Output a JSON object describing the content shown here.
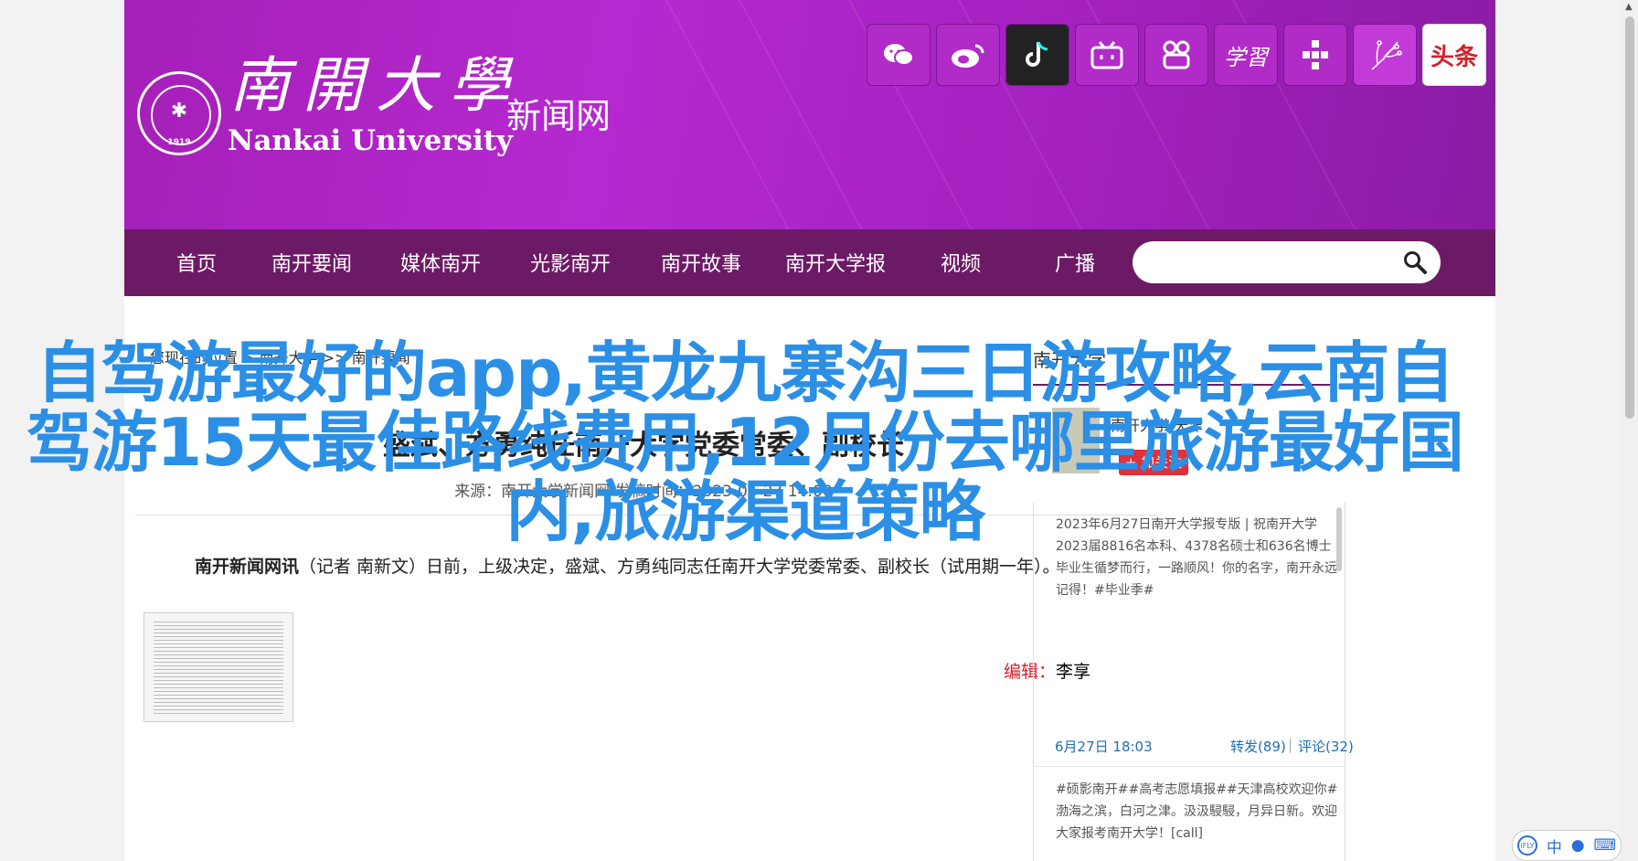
{
  "header": {
    "logo_cn": "南開大學",
    "logo_en": "Nankai University",
    "site_name": "新闻网",
    "emblem_year": "1919",
    "social_icons": [
      "wechat-icon",
      "weibo-icon",
      "douyin-icon",
      "bilibili-icon",
      "kuaishou-icon",
      "xuexi-icon",
      "app-icon",
      "flower-icon",
      "toutiao-icon"
    ],
    "toutiao_label": "头条"
  },
  "nav": {
    "items": [
      "首页",
      "南开要闻",
      "媒体南开",
      "光影南开",
      "南开故事",
      "南开大学报",
      "视频",
      "广播"
    ],
    "search_placeholder": ""
  },
  "article": {
    "breadcrumb": "您现在的位置 > 南开大学 >> 南开要闻",
    "title": "盛斌、方勇纯任南开大学党委常委、副校长",
    "meta": "来源：南开大学新闻网    发稿时间：2023-06-27 14:00",
    "body_lead": "南开新闻网讯",
    "body_text": "（记者 南新文）日前，上级决定，盛斌、方勇纯同志任南开大学党委常委、副校长（试用期一年）。",
    "editor_label": "编辑：",
    "editor_name": "李享"
  },
  "sidebar": {
    "heading": "南开大学",
    "weibo_name": "南开大学 天津",
    "follow_label": "+ 加关注",
    "feed_text_1": "2023年6月27日南开大学报专版 | 祝南开大学2023届8816名本科、4378名硕士和636名博士毕业生循梦而行，一路顺风！你的名字，南开永远记得！#毕业季#",
    "feed_date": "6月27日 18:03",
    "feed_repost": "转发(89)",
    "feed_sep": "|",
    "feed_comment": "评论(32)",
    "feed_text_2": "#硕影南开##高考志愿填报##天津高校欢迎你# 渤海之滨，白河之津。汲汲駸駸，月异日新。欢迎大家报考南开大学！[call]"
  },
  "overlay": {
    "text": "自驾游最好的app,黄龙九寨沟三日游攻略,云南自驾游15天最佳路线费用,12月份去哪里旅游最好国内,旅游渠道策略"
  },
  "ime": {
    "logo": "iFLY",
    "lang": "中",
    "icons": [
      "voice-icon",
      "keyboard-icon"
    ]
  }
}
